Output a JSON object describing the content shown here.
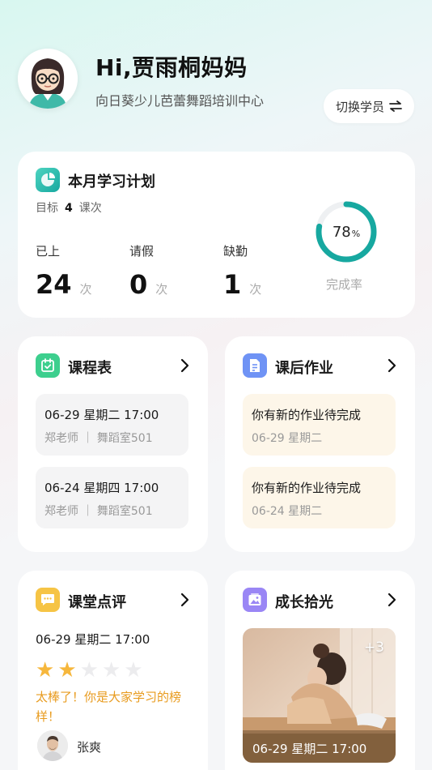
{
  "header": {
    "greeting": "Hi,贾雨桐妈妈",
    "school": "向日葵少儿芭蕾舞蹈培训中心",
    "switch_label": "切换学员"
  },
  "plan": {
    "title": "本月学习计划",
    "goal_label": "目标",
    "goal_value": "4",
    "goal_unit": "课次",
    "stats": [
      {
        "label": "已上",
        "value": "24",
        "unit": "次"
      },
      {
        "label": "请假",
        "value": "0",
        "unit": "次"
      },
      {
        "label": "缺勤",
        "value": "1",
        "unit": "次"
      }
    ],
    "rate_value": "78",
    "rate_symbol": "%",
    "rate_fraction": 0.78,
    "rate_label": "完成率"
  },
  "schedule": {
    "title": "课程表",
    "items": [
      {
        "time": "06-29 星期二 17:00",
        "detail": "郑老师 ｜ 舞蹈室501"
      },
      {
        "time": "06-24 星期四 17:00",
        "detail": "郑老师 ｜ 舞蹈室501"
      }
    ]
  },
  "homework": {
    "title": "课后作业",
    "items": [
      {
        "text": "你有新的作业待完成",
        "date": "06-29 星期二"
      },
      {
        "text": "你有新的作业待完成",
        "date": "06-24 星期二"
      }
    ]
  },
  "review": {
    "title": "课堂点评",
    "time": "06-29 星期二 17:00",
    "rating": 2,
    "max_rating": 5,
    "comment": "太棒了！你是大家学习的榜样！",
    "teacher": "张爽"
  },
  "growth": {
    "title": "成长拾光",
    "extra_count": "+3",
    "photo_time": "06-29 星期二 17:00"
  },
  "colors": {
    "teal": "#17a8a0",
    "schedule_icon": "#3dcf8e",
    "homework_icon": "#6f93f5",
    "review_icon": "#f6c445",
    "growth_icon": "#9a86f5",
    "star_on": "#f6b73c",
    "comment": "#e89b1e"
  }
}
